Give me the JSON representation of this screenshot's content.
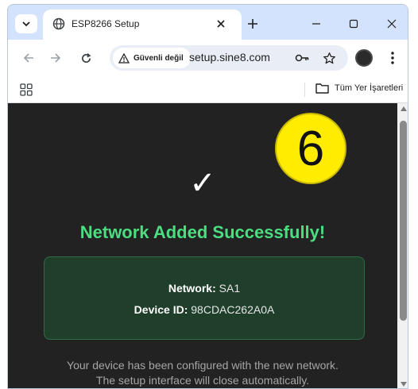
{
  "browser": {
    "tab_title": "ESP8266 Setup",
    "url": "setup.sine8.com",
    "security_label": "Güvenli değil",
    "bookmarks_folder_label": "Tüm Yer İşaretleri"
  },
  "page": {
    "step_number": "6",
    "checkmark": "✓",
    "title": "Network Added Successfully!",
    "network_label": "Network:",
    "network_value": "SA1",
    "device_label": "Device ID:",
    "device_value": "98CDAC262A0A",
    "footer_line1": "Your device has been configured with the new network.",
    "footer_line2": "The setup interface will close automatically."
  },
  "colors": {
    "page_background": "#222222",
    "success_green": "#4ade80",
    "info_box_background": "#203f2b",
    "badge_yellow": "#ffec00"
  },
  "icons": [
    "tab-search-icon",
    "globe-icon",
    "close-icon",
    "plus-icon",
    "minimize-icon",
    "maximize-icon",
    "back-arrow-icon",
    "forward-arrow-icon",
    "reload-icon",
    "warning-icon",
    "key-icon",
    "star-icon",
    "kebab-menu-icon",
    "apps-grid-icon",
    "folder-icon"
  ]
}
